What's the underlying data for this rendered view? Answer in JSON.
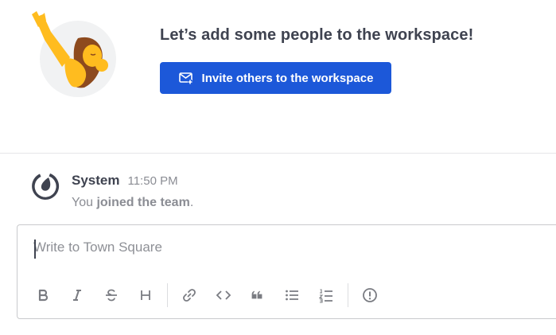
{
  "intro": {
    "heading": "Let’s add some people to the workspace!",
    "invite_button_label": "Invite others to the workspace",
    "illustration_icon": "person-waving-illustration",
    "accent_color": "#1c58d9"
  },
  "post": {
    "author": "System",
    "time": "11:50 PM",
    "message_prefix": "You",
    "message_bold": "joined the team",
    "message_suffix": ".",
    "avatar_icon": "mattermost-logo-icon"
  },
  "composer": {
    "placeholder": "Write to Town Square",
    "value": "",
    "toolbar": [
      {
        "name": "bold-icon",
        "label": "B"
      },
      {
        "name": "italic-icon",
        "label": "I"
      },
      {
        "name": "strikethrough-icon",
        "label": "S"
      },
      {
        "name": "heading-icon",
        "label": "H"
      },
      {
        "name": "link-icon",
        "label": ""
      },
      {
        "name": "code-icon",
        "label": ""
      },
      {
        "name": "quote-icon",
        "label": ""
      },
      {
        "name": "bulleted-list-icon",
        "label": ""
      },
      {
        "name": "numbered-list-icon",
        "label": ""
      },
      {
        "name": "priority-icon",
        "label": ""
      }
    ]
  }
}
